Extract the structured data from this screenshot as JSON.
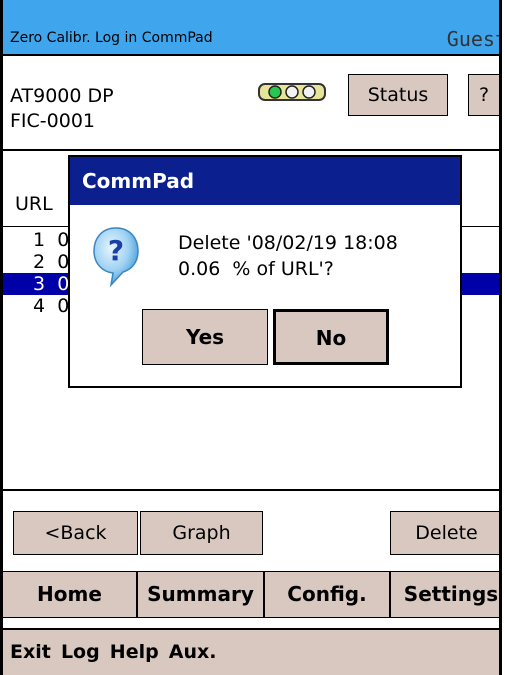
{
  "titlebar": {
    "app_title": "Zero Calibr. Log in CommPad",
    "user": "Guest",
    "bg": "#3fa6ee"
  },
  "device": {
    "model": "AT9000 DP",
    "tag": "FIC-0001"
  },
  "header_buttons": {
    "status": "Status",
    "help": "?"
  },
  "list": {
    "column_label": "URL",
    "rows": [
      {
        "num": "1",
        "prefix": "0"
      },
      {
        "num": "2",
        "prefix": "0"
      },
      {
        "num": "3",
        "prefix": "0"
      },
      {
        "num": "4",
        "prefix": "0"
      }
    ],
    "selected_index": 2,
    "selection_color": "#0000a8"
  },
  "nav_buttons": {
    "back": "<Back",
    "graph": "Graph",
    "delete": "Delete"
  },
  "tabs": [
    "Home",
    "Summary",
    "Config.",
    "Settings"
  ],
  "menu": [
    "Exit",
    "Log",
    "Help",
    "Aux."
  ],
  "dialog": {
    "title": "CommPad",
    "message_line1": "Delete '08/02/19 18:08",
    "message_line2": "0.06  % of URL'?",
    "yes": "Yes",
    "no": "No",
    "icon": "question-icon",
    "title_bg": "#0b1f8f"
  },
  "button_color": "#d8c8c0"
}
